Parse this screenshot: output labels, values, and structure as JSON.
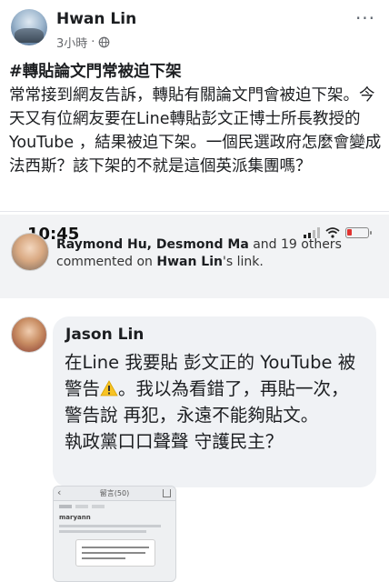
{
  "post": {
    "author": "Hwan Lin",
    "time": "3小時",
    "separator": "·",
    "more_label": "···",
    "hashtag": "#轉貼論文門常被迫下架",
    "body": "常常接到網友告訴，轉貼有關論文門會被迫下架。今天又有位網友要在Line轉貼彭文正博士所長教授的YouTube ，結果被迫下架。一個民選政府怎麼會變成法西斯？該下架的不就是這個英派集團嗎？"
  },
  "embedded_screenshot": {
    "status_time": "10:45",
    "notification": {
      "names_bold": "Raymond Hu, Desmond Ma",
      "middle": " and 19 others",
      "line2_prefix": "commented on ",
      "line2_bold": "Hwan Lin",
      "line2_suffix": "'s link."
    },
    "comment": {
      "name": "Jason Lin",
      "text_part1": "在Line 我要貼 彭文正的 YouTube 被警告",
      "text_part2": "。我以為看錯了，再貼一次，警告說 再犯，永遠不能夠貼文。",
      "text_part3": "執政黨口口聲聲 守護民主？"
    },
    "attached": {
      "title": "留言(50)",
      "user": "maryann"
    }
  },
  "icons": {
    "globe": "globe-icon",
    "more": "more-icon",
    "warning": "warning-icon",
    "signal": "signal-icon",
    "wifi": "wifi-icon",
    "battery": "battery-icon"
  },
  "colors": {
    "text": "#1c1e21",
    "meta": "#65676b",
    "bubble": "#f0f2f5",
    "battery_low": "#e0322f"
  }
}
